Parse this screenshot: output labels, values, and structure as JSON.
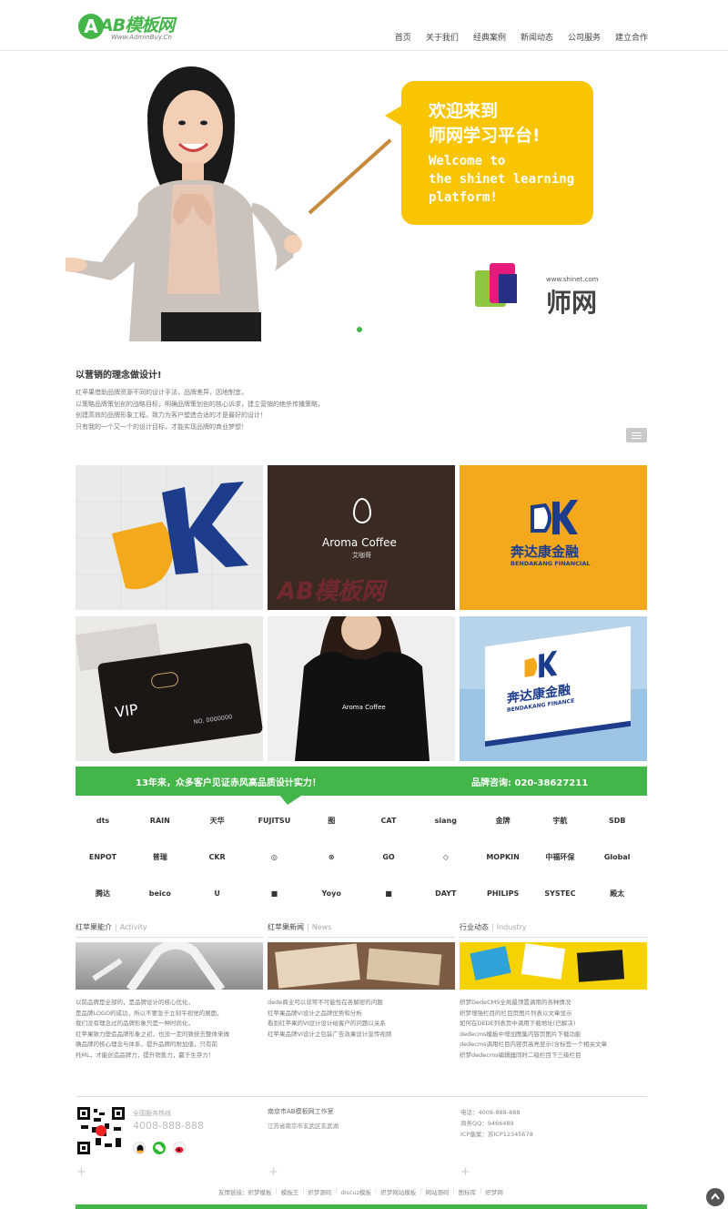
{
  "header": {
    "logo_mark": "A",
    "logo_text": "AB模板网",
    "logo_sub": "Www.AdminBuy.Cn",
    "nav": [
      "首页",
      "关于我们",
      "经典案例",
      "新闻动态",
      "公司服务",
      "建立合作"
    ]
  },
  "banner": {
    "bubble_cn": "欢迎来到\n师网学习平台!",
    "bubble_en": "Welcome to\nthe shinet learning\nplatform!",
    "brand_url": "www.shinet.com",
    "brand_name": "师网",
    "colors": {
      "yellow": "#f8c500",
      "green": "#44b549"
    }
  },
  "intro": {
    "title": "以营销的理念做设计!",
    "lines": [
      "红苹果借助品牌资源不同的设计手法，品牌差异，因地制宜。",
      "以策略品牌策划创的战略目标，明确品牌策划创的核心诉求，建立营销的绝杀传播策略，",
      "创建高效的品牌形象工程。致力为客户塑造合适的才是最好的设计！",
      "只有我的一个又一个的设计目标，才能实现品牌的商业梦想！"
    ]
  },
  "gallery": {
    "tiles": [
      {
        "label": "DK"
      },
      {
        "label": "Aroma Coffee",
        "sub": "艾咖哥"
      },
      {
        "label": "奔达康金融",
        "sub": "BENDAKANG FINANCIAL"
      },
      {
        "label": "VIP",
        "sub": "NO. 0000000"
      },
      {
        "label": "Aroma Coffee"
      },
      {
        "label": "奔达康金融",
        "sub": "BENDAKANG FINANCE"
      }
    ],
    "watermark": "AB模板网"
  },
  "green_bar": {
    "left_text": "13年来，众多客户见证赤风高品质设计实力！",
    "right_text": "品牌咨询: 020-38627211"
  },
  "clients": [
    "dts",
    "RAIN",
    "天华",
    "FUJITSU",
    "图",
    "CAT",
    "siang",
    "金牌",
    "宇航",
    "SDB",
    "ENPOT",
    "普瑞",
    "CKR",
    "◎",
    "⊛",
    "GO",
    "◇",
    "MOPKIN",
    "中福环保",
    "Global",
    "腾达",
    "beico",
    "U",
    "■",
    "Yoyo",
    "■",
    "DAYT",
    "PHILIPS",
    "SYSTEC",
    "殿太"
  ],
  "columns": [
    {
      "title": "红苹果能介",
      "en": "Activity",
      "lines": [
        "以前品牌是全部的，是品牌设计的核心优化，",
        "是品牌LOGO的成功，所以不要急于立刻平视觉的展面，",
        "我们没有理念过的品牌形象只是一种时尚化，",
        "红苹果致力塑造品牌形象之初，也没一定的致统去整体来做",
        "确品牌的核心理念与体系，提升品牌的附加值，只有前",
        "托ML，才能创造品牌力，提升销售力，赢于生存力！"
      ]
    },
    {
      "title": "红苹果新闻",
      "en": "News",
      "lines": [
        "dede商业可以非常不可能性在各解密的问题",
        "红苹果品牌VI设计之品牌优势和分析",
        "看到红苹果的VI设计设计给客户的问题以关系",
        "红苹果品牌VI设计之包装广告效果设计宣传视频"
      ]
    },
    {
      "title": "行业动态",
      "en": "Industry",
      "lines": [
        "织梦DedeCMS全局最顶置调用的各种情况",
        "织梦增强栏目的栏目页图片列表以文章显示",
        "如何在DEDE列表页中调用下载地址(已解决)",
        "dedecms模板中增加图集内容页图片下载功能",
        "dedecms调用栏目内容页高亮显示(含标签一个相关文章",
        "织梦dedecms编辑器同时二级栏目下三级栏目"
      ]
    }
  ],
  "footer": {
    "hotline_label": "全国服务热线",
    "hotline": "4008-888-888",
    "studio": "南京市AB模板网工作室",
    "address": "江苏省南京市玄武区玄武湖",
    "phone": "电话：4008-888-888",
    "qq": "商务QQ：9466489",
    "icp": "ICP备案：苏ICP12345678",
    "links_label": "友情链接：",
    "links": [
      "织梦模板",
      "模板王",
      "织梦源码",
      "discuz模板",
      "织梦网站模板",
      "网站源码",
      "图标库",
      "织梦网"
    ]
  }
}
